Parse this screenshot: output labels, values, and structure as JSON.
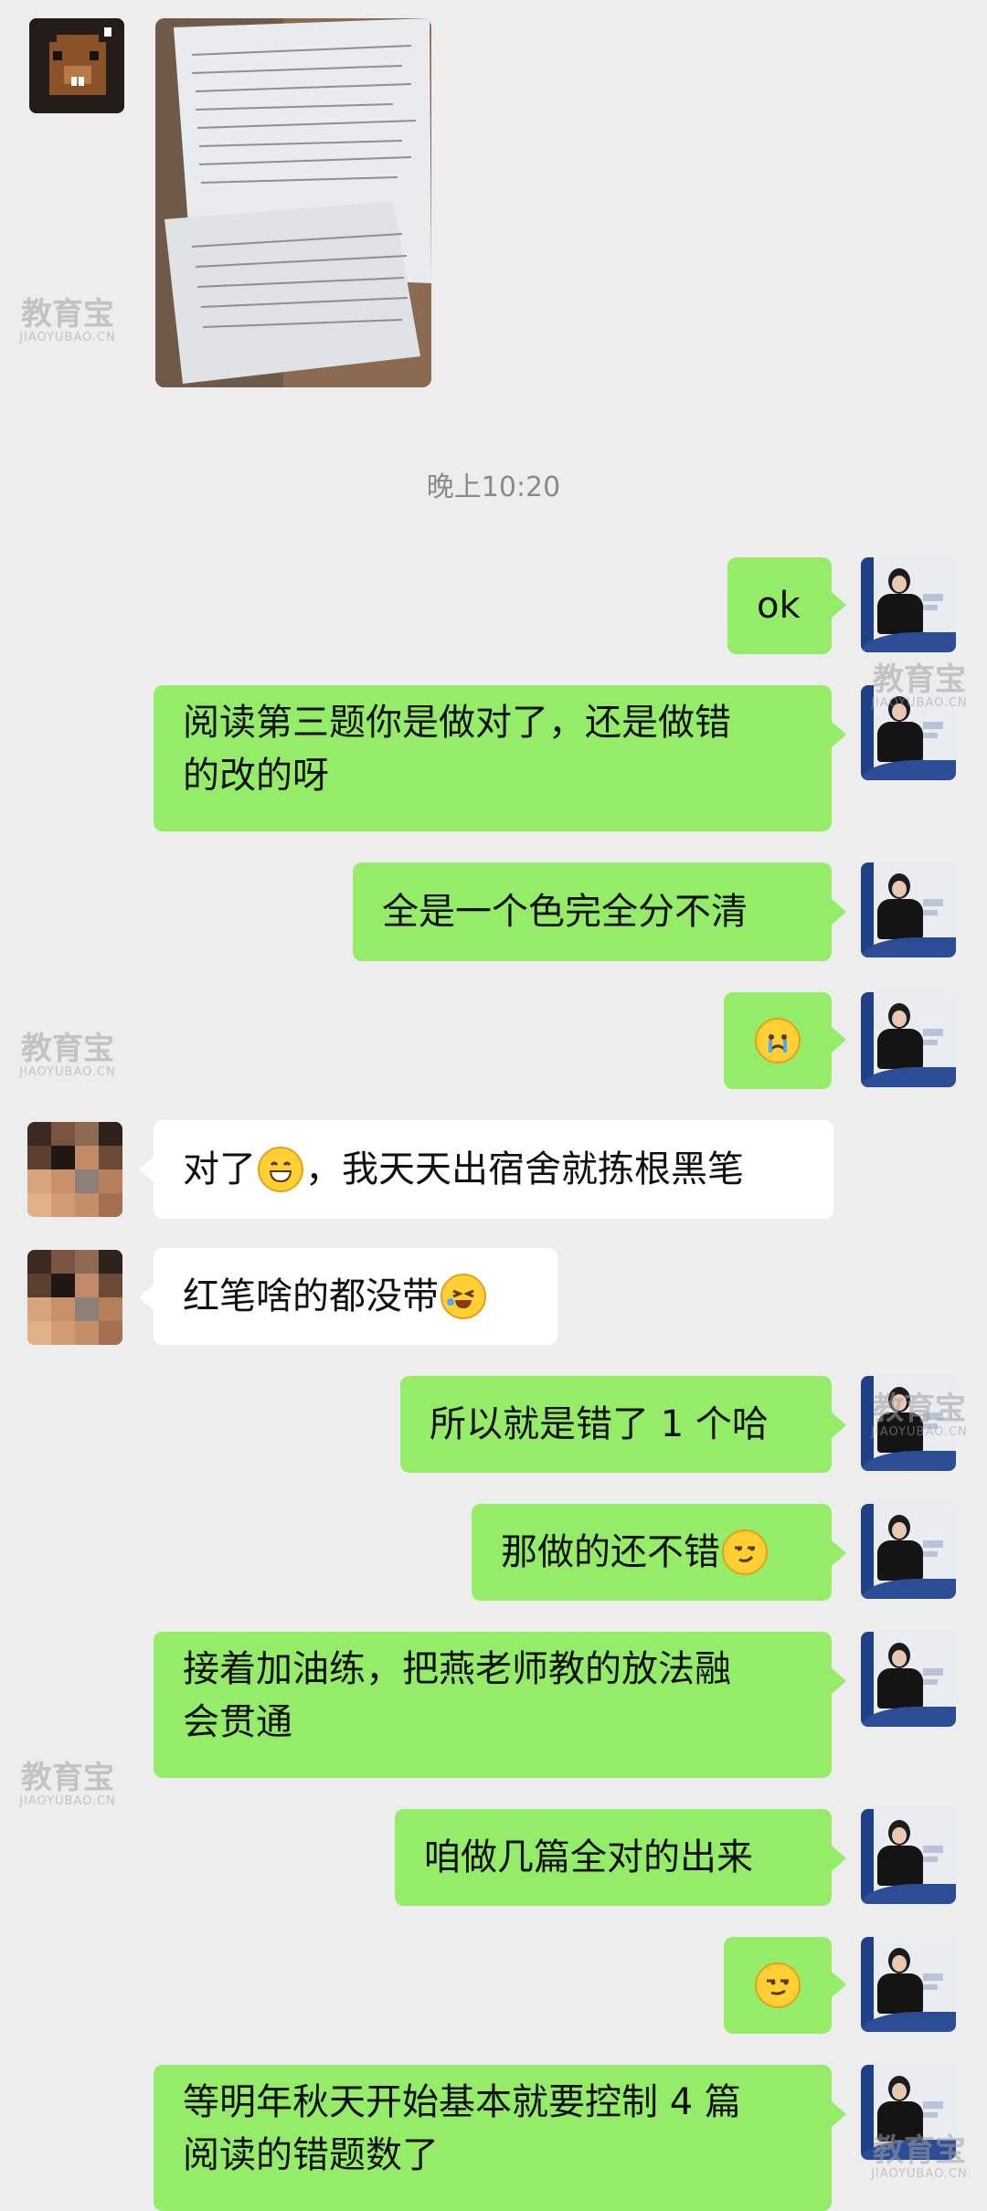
{
  "chat": {
    "timestamp": "晚上10:20",
    "watermark": {
      "cn": "教育宝",
      "en": "JIAOYUBAO.CN"
    },
    "messages": {
      "m1": "ok",
      "m2_line1": "阅读第三题你是做对了，还是做错",
      "m2_line2": "的改的呀",
      "m3": "全是一个色完全分不清",
      "m4_emoji": "crying-face-emoji",
      "m5_before": "对了",
      "m5_emoji": "grinning-face-emoji",
      "m5_after": "，我天天出宿舍就拣根黑笔",
      "m6_text": "红笔啥的都没带",
      "m6_emoji": "laughing-tears-emoji",
      "m7": "所以就是错了 1 个哈",
      "m8_text": "那做的还不错",
      "m8_emoji": "smirk-emoji",
      "m9_line1": "接着加油练，把燕老师教的放法融",
      "m9_line2": "会贯通",
      "m10": "咱做几篇全对的出来",
      "m11_emoji": "smirk-face-emoji",
      "m12_line1": "等明年秋天开始基本就要控制 4 篇",
      "m12_line2": "阅读的错题数了"
    }
  },
  "colors": {
    "background": "#ededed",
    "bubble_green": "#95ec69",
    "bubble_white": "#ffffff",
    "timestamp": "#8a8a8a"
  }
}
